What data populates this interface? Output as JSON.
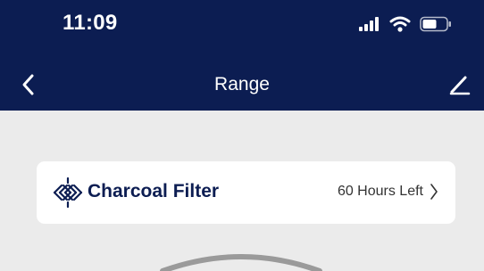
{
  "status_bar": {
    "time": "11:09",
    "icons": [
      "signal-icon",
      "wifi-icon",
      "battery-icon"
    ]
  },
  "nav": {
    "title": "Range",
    "back_icon": "chevron-left-icon",
    "edit_icon": "pencil-icon"
  },
  "filter_card": {
    "icon": "charcoal-filter-icon",
    "title": "Charcoal Filter",
    "status": "60 Hours Left",
    "chevron_icon": "chevron-right-icon"
  },
  "colors": {
    "header_bg": "#0c1d52",
    "page_bg": "#ebebeb",
    "card_bg": "#ffffff",
    "brand_text": "#0c1d52",
    "gauge_ring": "#9a9a9a"
  }
}
